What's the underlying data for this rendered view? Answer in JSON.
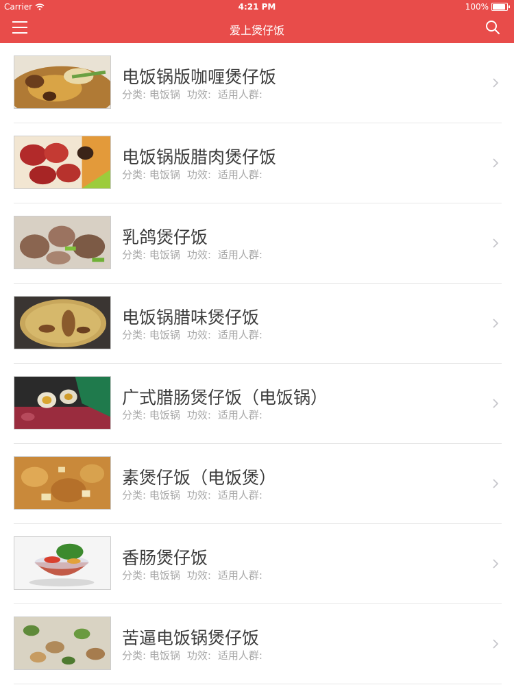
{
  "status": {
    "carrier": "Carrier",
    "time": "4:21 PM",
    "battery": "100%",
    "battery_level": 1.0
  },
  "nav": {
    "title": "爱上煲仔饭",
    "menu_icon": "menu-icon",
    "search_icon": "search-icon"
  },
  "meta_labels": {
    "category": "分类: 电饭锅",
    "effect": "功效:",
    "audience": "适用人群:"
  },
  "items": [
    {
      "title": "电饭锅版咖喱煲仔饭",
      "category": "分类: 电饭锅",
      "effect": "功效:",
      "audience": "适用人群:"
    },
    {
      "title": "电饭锅版腊肉煲仔饭",
      "category": "分类: 电饭锅",
      "effect": "功效:",
      "audience": "适用人群:"
    },
    {
      "title": "乳鸽煲仔饭",
      "category": "分类: 电饭锅",
      "effect": "功效:",
      "audience": "适用人群:"
    },
    {
      "title": "电饭锅腊味煲仔饭",
      "category": "分类: 电饭锅",
      "effect": "功效:",
      "audience": "适用人群:"
    },
    {
      "title": "广式腊肠煲仔饭（电饭锅）",
      "category": "分类: 电饭锅",
      "effect": "功效:",
      "audience": "适用人群:"
    },
    {
      "title": "素煲仔饭（电饭煲）",
      "category": "分类: 电饭锅",
      "effect": "功效:",
      "audience": "适用人群:"
    },
    {
      "title": "香肠煲仔饭",
      "category": "分类: 电饭锅",
      "effect": "功效:",
      "audience": "适用人群:"
    },
    {
      "title": "苦逼电饭锅煲仔饭",
      "category": "分类: 电饭锅",
      "effect": "功效:",
      "audience": "适用人群:"
    }
  ],
  "colors": {
    "nav_bg": "#e84c4a",
    "title_text": "#3c3c3c",
    "meta_text": "#a8a8a8",
    "chevron": "#c7c7cc"
  }
}
